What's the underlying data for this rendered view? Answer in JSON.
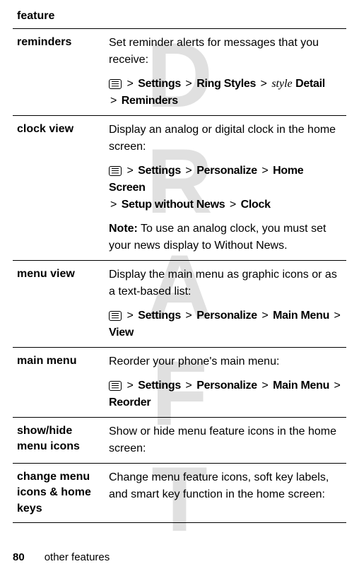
{
  "watermark": "DRAFT",
  "header": "feature",
  "rows": [
    {
      "title": "reminders",
      "desc": "Set reminder alerts for messages that you receive:",
      "path_parts": [
        "Settings",
        "Ring Styles"
      ],
      "path_style": "style",
      "path_after_style": "Detail",
      "path_line2": "Reminders"
    },
    {
      "title": "clock view",
      "desc": "Display an analog or digital clock in the home screen:",
      "path_parts": [
        "Settings",
        "Personalize",
        "Home Screen"
      ],
      "path_line2_parts": [
        "Setup without News",
        "Clock"
      ],
      "note_label": "Note:",
      "note_text_before": " To use an analog clock, you must set your news display to ",
      "note_bold": "Without News",
      "note_text_after": "."
    },
    {
      "title": "menu view",
      "desc": "Display the main menu as graphic icons or as a text-based list:",
      "path_parts": [
        "Settings",
        "Personalize",
        "Main Menu",
        "View"
      ]
    },
    {
      "title": "main menu",
      "desc": "Reorder your phone's main menu:",
      "path_parts": [
        "Settings",
        "Personalize",
        "Main Menu",
        "Reorder"
      ]
    },
    {
      "title": "show/hide menu icons",
      "desc": "Show or hide menu feature icons in the home screen:"
    },
    {
      "title": "change menu icons & home keys",
      "desc": "Change menu feature icons, soft key labels, and smart key function in the home screen:"
    }
  ],
  "footer": {
    "page": "80",
    "section": "other features"
  },
  "sep": ">"
}
